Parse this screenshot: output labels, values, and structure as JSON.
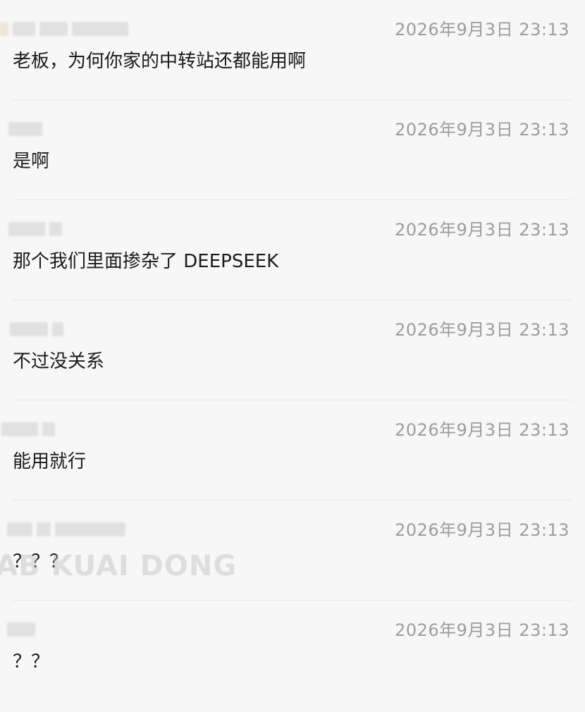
{
  "messages": [
    {
      "time": "2026年9月3日 23:13",
      "text": "老板，为何你家的中转站还都能用啊"
    },
    {
      "time": "2026年9月3日 23:13",
      "text": "是啊"
    },
    {
      "time": "2026年9月3日 23:13",
      "text": "那个我们里面掺杂了 DEEPSEEK"
    },
    {
      "time": "2026年9月3日 23:13",
      "text": "不过没关系"
    },
    {
      "time": "2026年9月3日 23:13",
      "text": "能用就行"
    },
    {
      "time": "2026年9月3日 23:13",
      "text": "？？？"
    },
    {
      "time": "2026年9月3日 23:13",
      "text": "？？"
    }
  ],
  "watermark": "AB KUAI DONG"
}
